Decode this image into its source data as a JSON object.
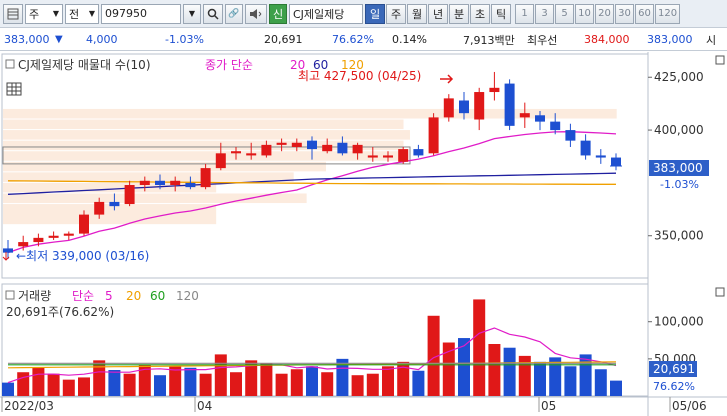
{
  "toolbar": {
    "menu_icon": "grid-menu-icon",
    "market_label": "주",
    "prev_label": "전",
    "code": "097950",
    "search_icon": "search-icon",
    "link_icon": "link-icon",
    "sound_icon": "speaker-icon",
    "new_label": "신",
    "stock_name": "CJ제일제당",
    "periods": [
      "일",
      "주",
      "월",
      "년",
      "분",
      "초",
      "틱"
    ],
    "active_period": "일",
    "minutes": [
      "1",
      "3",
      "5",
      "10",
      "20",
      "30",
      "60",
      "120"
    ]
  },
  "quote": {
    "price": "383,000",
    "change_arrow": "▼",
    "change": "4,000",
    "change_pct": "-1.03%",
    "volume": "20,691",
    "volume_ratio": "76.62%",
    "turnover": "0.14%",
    "amount": "7,913백만",
    "sell_label": "최우선",
    "ask": "384,000",
    "bid": "383,000",
    "tail": "시"
  },
  "price_panel": {
    "title": "CJ제일제당 매물대 수(10)",
    "ma_label": "종가 단순",
    "ma_periods": [
      "20",
      "60",
      "120"
    ],
    "ma_colors": [
      "#e01cc8",
      "#2020a0",
      "#f0a000"
    ],
    "high_label": "최고 427,500 (04/25)",
    "low_label": "←최저 339,000 (03/16)",
    "current_price": "383,000",
    "current_pct": "-1.03%",
    "y_ticks": [
      "425,000",
      "400,000",
      "350,000"
    ]
  },
  "volume_panel": {
    "title": "거래량",
    "ma_label": "단순",
    "ma_periods": [
      "5",
      "20",
      "60",
      "120"
    ],
    "ma_colors": [
      "#e01cc8",
      "#f0a000",
      "#20a020",
      "#888888"
    ],
    "info": "20,691주(76.62%)",
    "current_volume": "20,691",
    "current_pct": "76.62%",
    "y_ticks": [
      "100,000",
      "50,000"
    ]
  },
  "x_axis": {
    "labels": [
      "2022/03",
      "04",
      "05",
      "05/06"
    ]
  },
  "chart_data": [
    {
      "type": "candlestick",
      "series": [
        {
          "name": "price",
          "values": [
            [
              344000,
              348000,
              339000,
              342000
            ],
            [
              345000,
              350000,
              343000,
              347000
            ],
            [
              347000,
              351000,
              345000,
              349000
            ],
            [
              349000,
              352000,
              348000,
              350000
            ],
            [
              350000,
              352000,
              348000,
              351000
            ],
            [
              351000,
              362000,
              350000,
              360000
            ],
            [
              360000,
              368000,
              358000,
              366000
            ],
            [
              366000,
              370000,
              362000,
              364000
            ],
            [
              365000,
              376000,
              364000,
              374000
            ],
            [
              374000,
              378000,
              371000,
              376000
            ],
            [
              376000,
              379000,
              372000,
              374000
            ],
            [
              374000,
              378000,
              371000,
              376000
            ],
            [
              375000,
              378000,
              372000,
              373000
            ],
            [
              373000,
              384000,
              372000,
              382000
            ],
            [
              382000,
              394000,
              381000,
              389000
            ],
            [
              389000,
              392000,
              386000,
              390000
            ],
            [
              388000,
              394000,
              386000,
              389000
            ],
            [
              388000,
              395000,
              387000,
              393000
            ],
            [
              393000,
              396000,
              390000,
              394000
            ],
            [
              392000,
              396000,
              390000,
              394000
            ],
            [
              395000,
              397000,
              386000,
              391000
            ],
            [
              390000,
              396000,
              389000,
              393000
            ],
            [
              394000,
              397000,
              388000,
              389000
            ],
            [
              389000,
              394000,
              386000,
              393000
            ],
            [
              387000,
              392000,
              385000,
              388000
            ],
            [
              387000,
              390000,
              385000,
              388000
            ],
            [
              385000,
              392000,
              384000,
              391000
            ],
            [
              391000,
              393000,
              387000,
              388000
            ],
            [
              389000,
              408000,
              388000,
              406000
            ],
            [
              406000,
              417000,
              404000,
              415000
            ],
            [
              414000,
              418000,
              405000,
              408000
            ],
            [
              405000,
              420000,
              400000,
              418000
            ],
            [
              418000,
              427500,
              414000,
              420000
            ],
            [
              422000,
              424000,
              400000,
              402000
            ],
            [
              406000,
              413000,
              401000,
              408000
            ],
            [
              407000,
              409000,
              400000,
              404000
            ],
            [
              404000,
              408000,
              398000,
              400000
            ],
            [
              400000,
              403000,
              392000,
              395000
            ],
            [
              395000,
              398000,
              386000,
              388000
            ],
            [
              388000,
              391000,
              384000,
              387000
            ],
            [
              387000,
              389000,
              381000,
              383000
            ]
          ]
        }
      ],
      "y_unit": "KRW"
    },
    {
      "type": "bar",
      "series": [
        {
          "name": "volume",
          "values": [
            18000,
            32000,
            38000,
            30000,
            22000,
            25000,
            48000,
            35000,
            30000,
            42000,
            28000,
            40000,
            38000,
            30000,
            56000,
            32000,
            48000,
            44000,
            30000,
            36000,
            40000,
            32000,
            50000,
            28000,
            30000,
            40000,
            46000,
            34000,
            108000,
            72000,
            78000,
            130000,
            70000,
            65000,
            54000,
            46000,
            52000,
            40000,
            56000,
            36000,
            20691
          ]
        }
      ]
    }
  ]
}
